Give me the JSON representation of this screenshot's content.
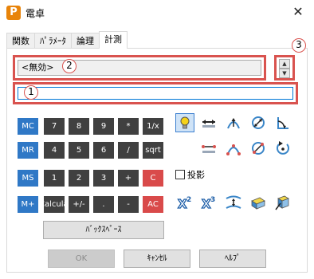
{
  "window": {
    "title": "電卓",
    "app_icon_letter": "P",
    "close_glyph": "✕"
  },
  "tabs": [
    {
      "label": "関数",
      "active": false
    },
    {
      "label": "ﾊﾟﾗﾒｰﾀ",
      "active": false
    },
    {
      "label": "論理",
      "active": false
    },
    {
      "label": "計測",
      "active": true
    }
  ],
  "display": {
    "result_text": "<無効>",
    "input_value": ""
  },
  "callouts": {
    "input": "1",
    "result": "2",
    "spinner": "3"
  },
  "spinner": {
    "up": "▲",
    "down": "▼"
  },
  "keypad": {
    "row1": [
      "MC",
      "7",
      "8",
      "9",
      "*",
      "1/x"
    ],
    "row2": [
      "MR",
      "4",
      "5",
      "6",
      "/",
      "sqrt"
    ],
    "row3": [
      "MS",
      "1",
      "2",
      "3",
      "+",
      "C"
    ],
    "row4": [
      "M+",
      "Calculate",
      "+/-",
      ".",
      "-",
      "AC"
    ]
  },
  "buttons": {
    "backspace": "ﾊﾞｯｸｽﾍﾟｰｽ",
    "ok": "OK",
    "cancel": "ｷｬﾝｾﾙ",
    "help": "ﾍﾙﾌﾟ"
  },
  "projection": {
    "label": "投影",
    "checked": false
  },
  "tools": {
    "row1": [
      "lightbulb-icon",
      "measure-distance-icon",
      "measure-arc-icon",
      "measure-diameter-icon",
      "measure-angle-icon"
    ],
    "row2": [
      "point-distance-icon",
      "three-point-arc-icon",
      "circle-diameter-icon",
      "rotation-icon"
    ],
    "row3": [
      "square-icon",
      "cube-icon",
      "surface-icon",
      "solid-icon",
      "section-icon"
    ]
  },
  "colors": {
    "key_dark": "#404040",
    "key_memory": "#2f78c6",
    "key_clear": "#d94a4a",
    "annotation_red": "#d9534f"
  }
}
